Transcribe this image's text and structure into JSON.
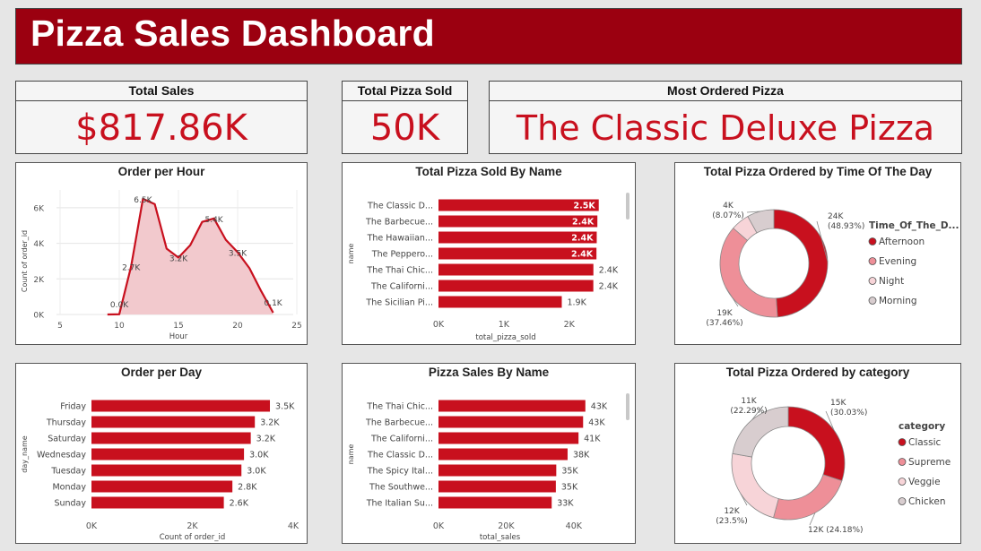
{
  "title": "Pizza Sales Dashboard",
  "kpis": {
    "total_sales": {
      "label": "Total Sales",
      "value": "$817.86K"
    },
    "total_sold": {
      "label": "Total Pizza Sold",
      "value": "50K"
    },
    "most_ordered": {
      "label": "Most Ordered Pizza",
      "value": "The Classic Deluxe Pizza"
    }
  },
  "colors": {
    "accent": "#c8101e",
    "banner": "#9b0010",
    "area_fill": "#f2c9cd",
    "pink": "#ee8f98",
    "light_pink": "#f7d4d8",
    "grey": "#d8cdcf"
  },
  "chart_data": [
    {
      "id": "order_per_hour",
      "type": "area",
      "title": "Order per Hour",
      "xlabel": "Hour",
      "ylabel": "Count of order_id",
      "xlim": [
        5,
        25
      ],
      "ylim": [
        0,
        7000
      ],
      "x_ticks": [
        "5",
        "10",
        "15",
        "20",
        "25"
      ],
      "y_ticks": [
        "0K",
        "2K",
        "4K",
        "6K"
      ],
      "x": [
        9,
        10,
        11,
        12,
        13,
        14,
        15,
        16,
        17,
        18,
        19,
        20,
        21,
        22,
        23
      ],
      "values": [
        1,
        8,
        2700,
        6500,
        6200,
        3700,
        3200,
        3900,
        5200,
        5400,
        4200,
        3500,
        2600,
        1300,
        100
      ],
      "labels": [
        {
          "x": 10,
          "y": 8,
          "text": "0.0K"
        },
        {
          "x": 11,
          "y": 2700,
          "text": "2.7K"
        },
        {
          "x": 12,
          "y": 6500,
          "text": "6.5K"
        },
        {
          "x": 15,
          "y": 3200,
          "text": "3.2K"
        },
        {
          "x": 18,
          "y": 5400,
          "text": "5.4K"
        },
        {
          "x": 20,
          "y": 3500,
          "text": "3.5K"
        },
        {
          "x": 23,
          "y": 100,
          "text": "0.1K"
        }
      ],
      "grid": true
    },
    {
      "id": "pizza_sold_by_name",
      "type": "bar",
      "title": "Total Pizza Sold By Name",
      "xlabel": "total_pizza_sold",
      "ylabel": "name",
      "xlim": [
        0,
        2800
      ],
      "x_ticks": [
        {
          "v": 0,
          "t": "0K"
        },
        {
          "v": 1000,
          "t": "1K"
        },
        {
          "v": 2000,
          "t": "2K"
        }
      ],
      "categories": [
        "The Classic D...",
        "The Barbecue...",
        "The Hawaiian...",
        "The Peppero...",
        "The Thai Chic...",
        "The Californi...",
        "The Sicilian Pi..."
      ],
      "values": [
        2453,
        2432,
        2422,
        2418,
        2371,
        2370,
        1887
      ],
      "value_labels": [
        "2.5K",
        "2.4K",
        "2.4K",
        "2.4K",
        "2.4K",
        "2.4K",
        "1.9K"
      ],
      "label_inside": [
        true,
        true,
        true,
        true,
        false,
        false,
        false
      ]
    },
    {
      "id": "time_of_day",
      "type": "pie",
      "title": "Total Pizza Ordered by Time Of The Day",
      "legend_title": "Time_Of_The_D...",
      "legend_position": "right",
      "slices": [
        {
          "name": "Afternoon",
          "value": 24,
          "pct": 48.93,
          "label": "24K",
          "pct_label": "(48.93%)",
          "color": "#c8101e"
        },
        {
          "name": "Evening",
          "value": 19,
          "pct": 37.46,
          "label": "19K",
          "pct_label": "(37.46%)",
          "color": "#ee8f98"
        },
        {
          "name": "Night",
          "value": 4,
          "pct": 5.54,
          "label": "",
          "pct_label": "",
          "color": "#f7d4d8"
        },
        {
          "name": "Morning",
          "value": 4,
          "pct": 8.07,
          "label": "4K",
          "pct_label": "(8.07%)",
          "color": "#d8cdcf"
        }
      ]
    },
    {
      "id": "order_per_day",
      "type": "bar",
      "title": "Order per Day",
      "xlabel": "Count of order_id",
      "ylabel": "day_name",
      "xlim": [
        0,
        4000
      ],
      "x_ticks": [
        {
          "v": 0,
          "t": "0K"
        },
        {
          "v": 2000,
          "t": "2K"
        },
        {
          "v": 4000,
          "t": "4K"
        }
      ],
      "categories": [
        "Friday",
        "Thursday",
        "Saturday",
        "Wednesday",
        "Tuesday",
        "Monday",
        "Sunday"
      ],
      "values": [
        3538,
        3239,
        3158,
        3024,
        2973,
        2794,
        2624
      ],
      "value_labels": [
        "3.5K",
        "3.2K",
        "3.2K",
        "3.0K",
        "3.0K",
        "2.8K",
        "2.6K"
      ]
    },
    {
      "id": "sales_by_name",
      "type": "bar",
      "title": "Pizza Sales By Name",
      "xlabel": "total_sales",
      "ylabel": "name",
      "xlim": [
        0,
        48000
      ],
      "x_ticks": [
        {
          "v": 0,
          "t": "0K"
        },
        {
          "v": 20000,
          "t": "20K"
        },
        {
          "v": 40000,
          "t": "40K"
        }
      ],
      "categories": [
        "The Thai Chic...",
        "The Barbecue...",
        "The Californi...",
        "The Classic D...",
        "The Spicy Ital...",
        "The Southwe...",
        "The Italian Su..."
      ],
      "values": [
        43434,
        42768,
        41410,
        38180,
        34831,
        34706,
        33476
      ],
      "value_labels": [
        "43K",
        "43K",
        "41K",
        "38K",
        "35K",
        "35K",
        "33K"
      ]
    },
    {
      "id": "by_category",
      "type": "pie",
      "title": "Total Pizza Ordered by category",
      "legend_title": "category",
      "legend_position": "right",
      "slices": [
        {
          "name": "Classic",
          "value": 15,
          "pct": 30.03,
          "label": "15K",
          "pct_label": "(30.03%)",
          "color": "#c8101e"
        },
        {
          "name": "Supreme",
          "value": 12,
          "pct": 24.18,
          "label": "12K (24.18%)",
          "pct_label": "",
          "color": "#ee8f98"
        },
        {
          "name": "Veggie",
          "value": 12,
          "pct": 23.5,
          "label": "12K",
          "pct_label": "(23.5%)",
          "color": "#f7d4d8"
        },
        {
          "name": "Chicken",
          "value": 11,
          "pct": 22.29,
          "label": "11K",
          "pct_label": "(22.29%)",
          "color": "#d8cdcf"
        }
      ]
    }
  ]
}
